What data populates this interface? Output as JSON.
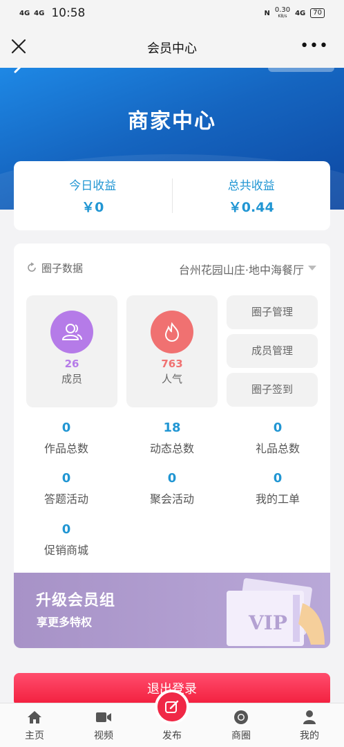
{
  "status_bar": {
    "signal1": "4G",
    "signal2": "4G",
    "time": "10:58",
    "nfc": "N",
    "speed": "0.30",
    "speed_unit": "KB/s",
    "net": "4G",
    "battery": "70"
  },
  "title_bar": {
    "title": "会员中心",
    "more": "•••"
  },
  "hero": {
    "title": "商家中心"
  },
  "earnings": {
    "today_label": "今日收益",
    "today_value": "￥0",
    "total_label": "总共收益",
    "total_value": "￥0.44"
  },
  "circle": {
    "label": "圈子数据",
    "name": "台州花园山庄·地中海餐厅",
    "members_count": "26",
    "members_label": "成员",
    "popularity_count": "763",
    "popularity_label": "人气",
    "manage_buttons": [
      "圈子管理",
      "成员管理",
      "圈子签到"
    ],
    "stats": [
      {
        "value": "0",
        "label": "作品总数"
      },
      {
        "value": "18",
        "label": "动态总数"
      },
      {
        "value": "0",
        "label": "礼品总数"
      },
      {
        "value": "0",
        "label": "答题活动"
      },
      {
        "value": "0",
        "label": "聚会活动"
      },
      {
        "value": "0",
        "label": "我的工单"
      },
      {
        "value": "0",
        "label": "促销商城"
      }
    ]
  },
  "upgrade": {
    "title": "升级会员组",
    "subtitle": "享更多特权",
    "badge": "VIP"
  },
  "logout_label": "退出登录",
  "tabs": [
    {
      "label": "主页",
      "icon": "home-icon"
    },
    {
      "label": "视频",
      "icon": "video-icon"
    },
    {
      "label": "发布",
      "icon": "edit-icon"
    },
    {
      "label": "商圈",
      "icon": "chrome-icon"
    },
    {
      "label": "我的",
      "icon": "user-icon"
    }
  ],
  "colors": {
    "accent_blue": "#2196d3",
    "purple": "#b57be8",
    "coral": "#f07171",
    "logout_red": "#f21c3b",
    "upgrade_purple": "#b3a1d2"
  }
}
